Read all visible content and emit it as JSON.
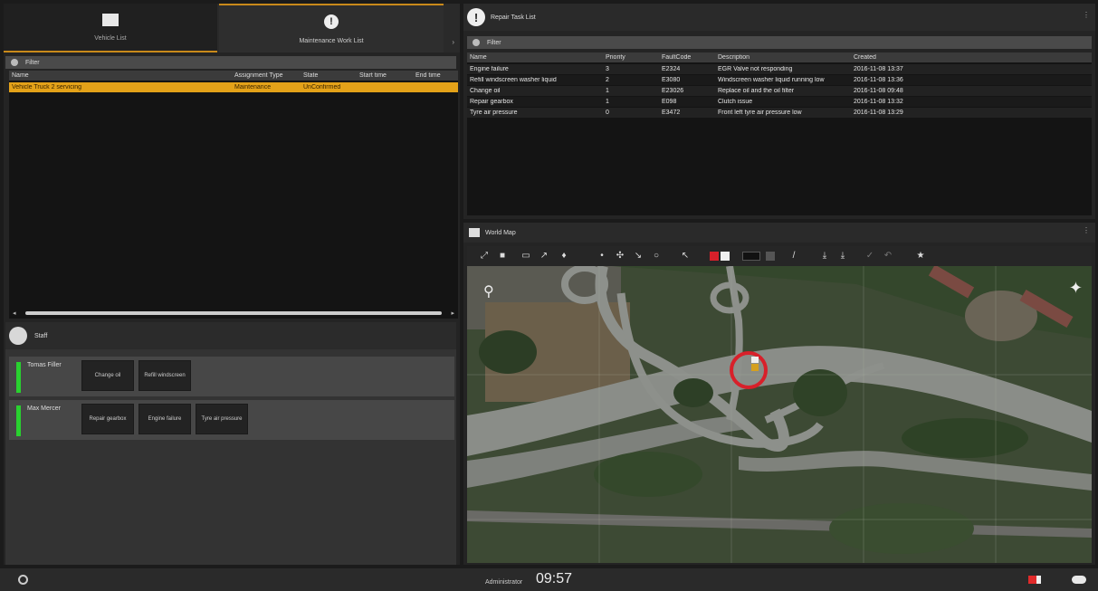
{
  "tabs": [
    {
      "label": "Vehicle List",
      "icon": "truck-icon"
    },
    {
      "label": "Maintenance Work List",
      "icon": "warning-icon"
    }
  ],
  "work_list": {
    "filter_label": "Filter",
    "columns": [
      "Name",
      "Assignment Type",
      "State",
      "Start time",
      "End time"
    ],
    "rows": [
      [
        "Vehicle Truck 2 servicing",
        "Maintenance",
        "UnConfirmed",
        "",
        ""
      ]
    ]
  },
  "staff": {
    "title": "Staff",
    "members": [
      {
        "name": "Tomas Filler",
        "tasks": [
          "Change oil",
          "Refill windscreen"
        ]
      },
      {
        "name": "Max Mercer",
        "tasks": [
          "Repair gearbox",
          "Engine failure",
          "Tyre air pressure"
        ]
      }
    ]
  },
  "repair_tasks": {
    "title": "Repair Task List",
    "filter_label": "Filter",
    "columns": [
      "Name",
      "Priority",
      "FaultCode",
      "Description",
      "Created"
    ],
    "rows": [
      [
        "Engine failure",
        "3",
        "E2324",
        "EGR Valve not responding",
        "2016-11-08 13:37"
      ],
      [
        "Refill windscreen washer liquid",
        "2",
        "E3080",
        "Windscreen washer liquid running low",
        "2016-11-08 13:36"
      ],
      [
        "Change oil",
        "1",
        "E23026",
        "Replace oil and the oil filter",
        "2016-11-08 09:48"
      ],
      [
        "Repair gearbox",
        "1",
        "E098",
        "Clutch issue",
        "2016-11-08 13:32"
      ],
      [
        "Tyre air pressure",
        "0",
        "E3472",
        "Front left tyre air pressure low",
        "2016-11-08 13:29"
      ]
    ]
  },
  "map": {
    "title": "World Map"
  },
  "footer": {
    "user": "Administrator",
    "time": "09:57"
  },
  "colors": {
    "accent": "#c98a1a",
    "selected_row": "#e4a219",
    "staff_ok": "#29d12f",
    "marker": "#d8202a"
  }
}
